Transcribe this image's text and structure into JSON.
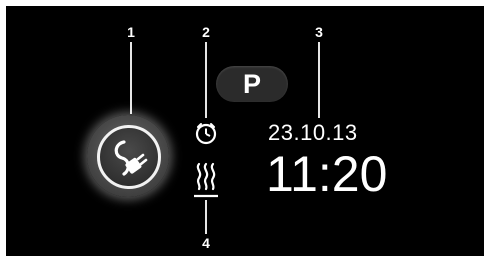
{
  "callouts": [
    "1",
    "2",
    "3",
    "4"
  ],
  "park_indicator": {
    "label": "P"
  },
  "datetime": {
    "date": "23.10.13",
    "time": "11:20"
  },
  "icons": {
    "charging": "plug-icon",
    "timer": "clock-icon",
    "heating": "heat-icon"
  },
  "colors": {
    "background": "#000000",
    "foreground": "#ffffff",
    "button_face": "#4a4a4a",
    "pill": "#2b2b2b"
  }
}
